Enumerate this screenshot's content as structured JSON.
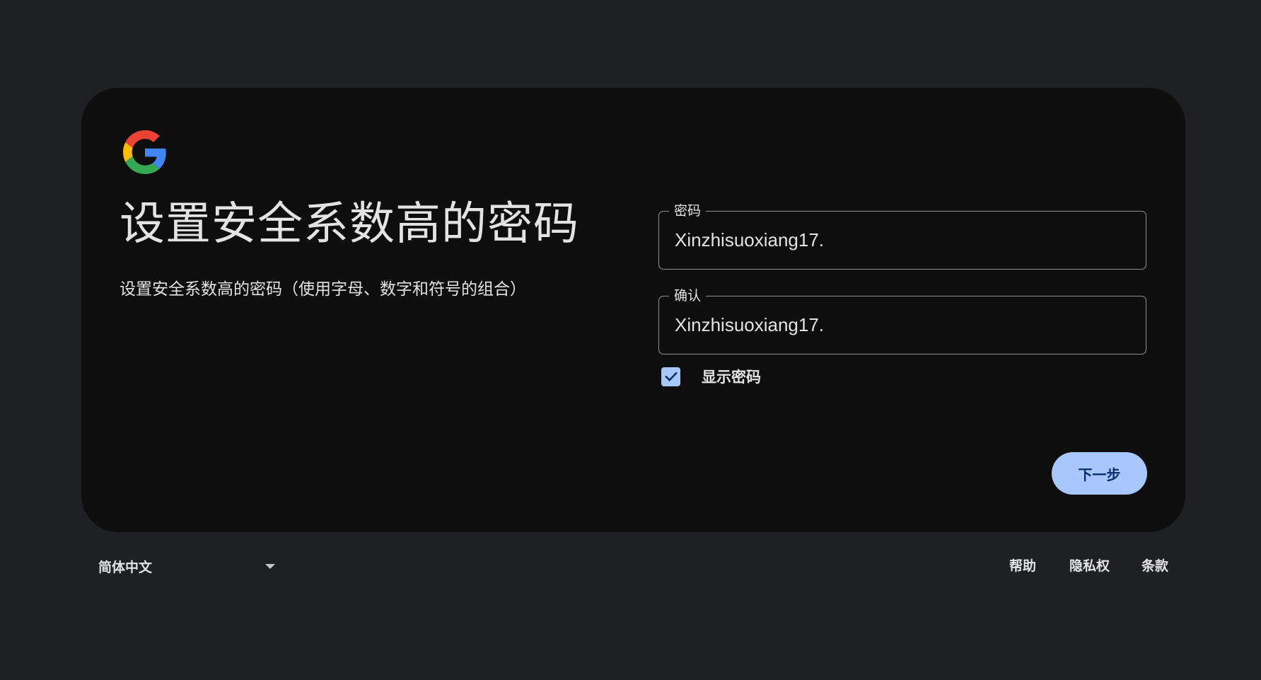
{
  "header": {
    "logo": "google-g-logo",
    "title": "设置安全系数高的密码",
    "subtitle": "设置安全系数高的密码（使用字母、数字和符号的组合）"
  },
  "form": {
    "password": {
      "label": "密码",
      "value": "Xinzhisuoxiang17."
    },
    "confirm": {
      "label": "确认",
      "value": "Xinzhisuoxiang17."
    },
    "show_password": {
      "label": "显示密码",
      "checked": true
    },
    "next_label": "下一步"
  },
  "footer": {
    "language": "简体中文",
    "help": "帮助",
    "privacy": "隐私权",
    "terms": "条款"
  },
  "colors": {
    "page_background": "#1f2023",
    "card_background": "#0e0e0f",
    "accent": "#a8c7fa",
    "button_text": "#062e6f",
    "text": "#e3e3e3",
    "field_border": "#8e918f"
  }
}
